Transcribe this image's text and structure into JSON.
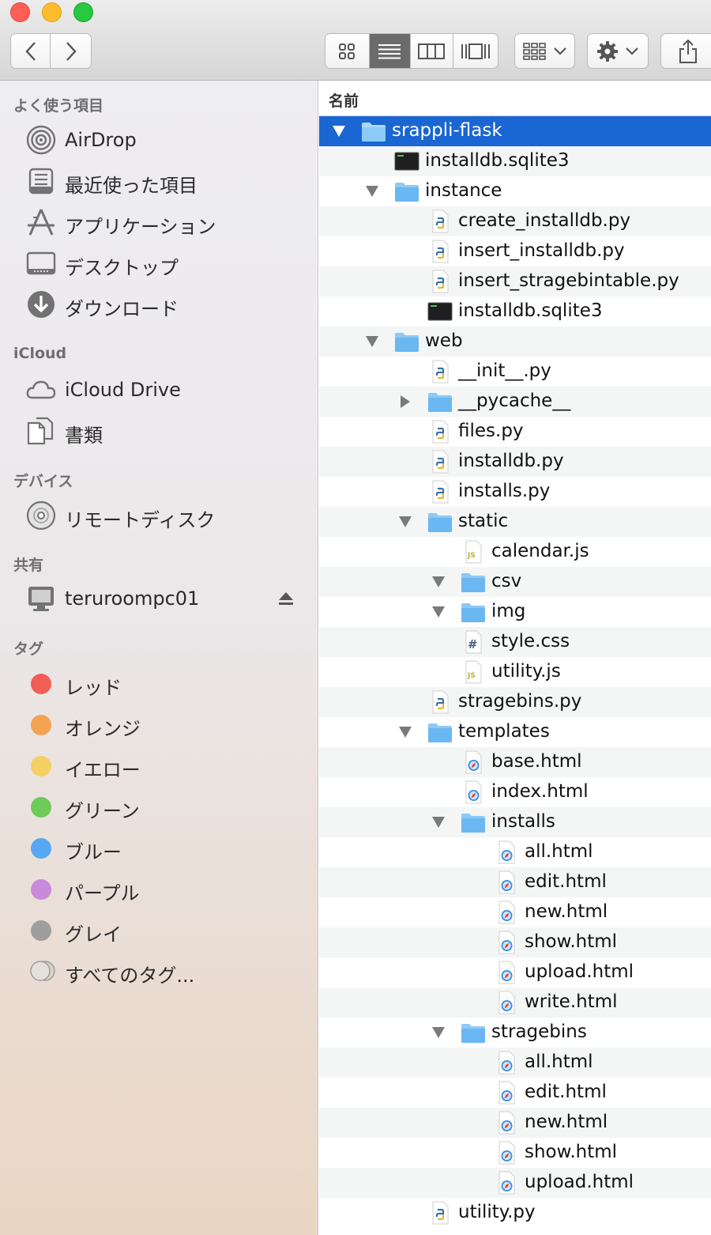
{
  "window": {
    "traffic_lights": [
      "close",
      "minimize",
      "zoom"
    ]
  },
  "toolbar": {
    "view_modes": [
      "icon",
      "list",
      "column",
      "cover-flow"
    ],
    "active_view": "list"
  },
  "sidebar": {
    "favorites_header": "よく使う項目",
    "favorites": [
      {
        "label": "AirDrop",
        "icon": "airdrop-icon"
      },
      {
        "label": "最近使った項目",
        "icon": "recents-icon"
      },
      {
        "label": "アプリケーション",
        "icon": "applications-icon"
      },
      {
        "label": "デスクトップ",
        "icon": "desktop-icon"
      },
      {
        "label": "ダウンロード",
        "icon": "downloads-icon"
      }
    ],
    "icloud_header": "iCloud",
    "icloud": [
      {
        "label": "iCloud Drive",
        "icon": "cloud-icon"
      },
      {
        "label": "書類",
        "icon": "documents-icon"
      }
    ],
    "devices_header": "デバイス",
    "devices": [
      {
        "label": "リモートディスク",
        "icon": "disc-icon"
      }
    ],
    "shared_header": "共有",
    "shared": [
      {
        "label": "teruroompc01",
        "icon": "computer-icon"
      }
    ],
    "tags_header": "タグ",
    "tags": [
      {
        "label": "レッド",
        "color": "#f15e55"
      },
      {
        "label": "オレンジ",
        "color": "#f3a352"
      },
      {
        "label": "イエロー",
        "color": "#f4d064"
      },
      {
        "label": "グリーン",
        "color": "#6ccb59"
      },
      {
        "label": "ブルー",
        "color": "#56a8f2"
      },
      {
        "label": "パープル",
        "color": "#c88ad9"
      },
      {
        "label": "グレイ",
        "color": "#9e9e9e"
      },
      {
        "label": "すべてのタグ...",
        "color": "all"
      }
    ]
  },
  "list": {
    "column_header": "名前",
    "rows": [
      {
        "name": "srappli-flask",
        "type": "folder",
        "level": 0,
        "disclosure": "open",
        "selected": true
      },
      {
        "name": "installdb.sqlite3",
        "type": "terminal",
        "level": 1,
        "disclosure": "none"
      },
      {
        "name": "instance",
        "type": "folder",
        "level": 1,
        "disclosure": "open"
      },
      {
        "name": "create_installdb.py",
        "type": "python",
        "level": 2,
        "disclosure": "none"
      },
      {
        "name": "insert_installdb.py",
        "type": "python",
        "level": 2,
        "disclosure": "none"
      },
      {
        "name": "insert_stragebintable.py",
        "type": "python",
        "level": 2,
        "disclosure": "none"
      },
      {
        "name": "installdb.sqlite3",
        "type": "terminal",
        "level": 2,
        "disclosure": "none"
      },
      {
        "name": "web",
        "type": "folder",
        "level": 1,
        "disclosure": "open"
      },
      {
        "name": "__init__.py",
        "type": "python",
        "level": 2,
        "disclosure": "none"
      },
      {
        "name": "__pycache__",
        "type": "folder",
        "level": 2,
        "disclosure": "closed"
      },
      {
        "name": "files.py",
        "type": "python",
        "level": 2,
        "disclosure": "none"
      },
      {
        "name": "installdb.py",
        "type": "python",
        "level": 2,
        "disclosure": "none"
      },
      {
        "name": "installs.py",
        "type": "python",
        "level": 2,
        "disclosure": "none"
      },
      {
        "name": "static",
        "type": "folder",
        "level": 2,
        "disclosure": "open"
      },
      {
        "name": "calendar.js",
        "type": "js",
        "level": 3,
        "disclosure": "none"
      },
      {
        "name": "csv",
        "type": "folder",
        "level": 3,
        "disclosure": "open"
      },
      {
        "name": "img",
        "type": "folder",
        "level": 3,
        "disclosure": "open"
      },
      {
        "name": "style.css",
        "type": "css",
        "level": 3,
        "disclosure": "none"
      },
      {
        "name": "utility.js",
        "type": "js",
        "level": 3,
        "disclosure": "none"
      },
      {
        "name": "stragebins.py",
        "type": "python",
        "level": 2,
        "disclosure": "none"
      },
      {
        "name": "templates",
        "type": "folder",
        "level": 2,
        "disclosure": "open"
      },
      {
        "name": "base.html",
        "type": "html",
        "level": 3,
        "disclosure": "none"
      },
      {
        "name": "index.html",
        "type": "html",
        "level": 3,
        "disclosure": "none"
      },
      {
        "name": "installs",
        "type": "folder",
        "level": 3,
        "disclosure": "open"
      },
      {
        "name": "all.html",
        "type": "html",
        "level": 4,
        "disclosure": "none"
      },
      {
        "name": "edit.html",
        "type": "html",
        "level": 4,
        "disclosure": "none"
      },
      {
        "name": "new.html",
        "type": "html",
        "level": 4,
        "disclosure": "none"
      },
      {
        "name": "show.html",
        "type": "html",
        "level": 4,
        "disclosure": "none"
      },
      {
        "name": "upload.html",
        "type": "html",
        "level": 4,
        "disclosure": "none"
      },
      {
        "name": "write.html",
        "type": "html",
        "level": 4,
        "disclosure": "none"
      },
      {
        "name": "stragebins",
        "type": "folder",
        "level": 3,
        "disclosure": "open"
      },
      {
        "name": "all.html",
        "type": "html",
        "level": 4,
        "disclosure": "none"
      },
      {
        "name": "edit.html",
        "type": "html",
        "level": 4,
        "disclosure": "none"
      },
      {
        "name": "new.html",
        "type": "html",
        "level": 4,
        "disclosure": "none"
      },
      {
        "name": "show.html",
        "type": "html",
        "level": 4,
        "disclosure": "none"
      },
      {
        "name": "upload.html",
        "type": "html",
        "level": 4,
        "disclosure": "none"
      },
      {
        "name": "utility.py",
        "type": "python",
        "level": 2,
        "disclosure": "none"
      }
    ]
  }
}
